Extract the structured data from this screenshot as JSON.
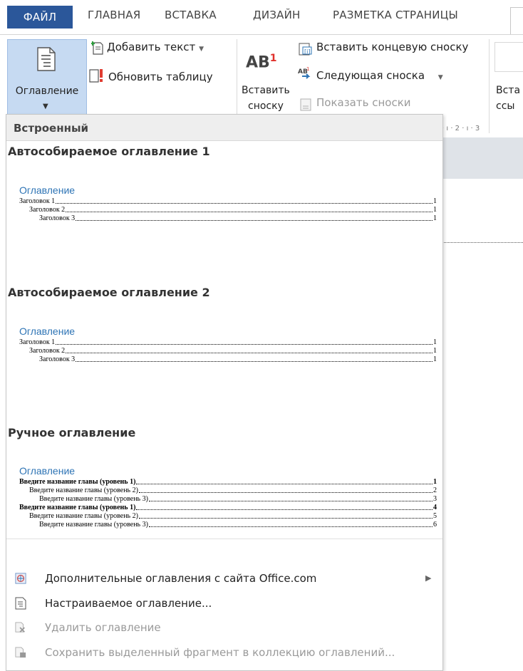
{
  "tabs": [
    "ФАЙЛ",
    "ГЛАВНАЯ",
    "ВСТАВКА",
    "ДИЗАЙН",
    "РАЗМЕТКА СТРАНИЦЫ"
  ],
  "ribbon": {
    "toc_button": "Оглавление",
    "add_text": "Добавить текст",
    "update_table": "Обновить таблицу",
    "insert_footnote_1": "Вставить",
    "insert_footnote_2": "сноску",
    "insert_endnote": "Вставить концевую сноску",
    "next_footnote": "Следующая сноска",
    "show_notes": "Показать сноски",
    "cut_1": "Вста",
    "cut_2": "ссы",
    "ab_text": "AB",
    "ab_sup": "1"
  },
  "ruler_text": "· ı · 2 · ı · 3",
  "menu": {
    "header": "Встроенный",
    "galleries": [
      {
        "title": "Автособираемое оглавление 1",
        "heading": "Оглавление",
        "rows": [
          {
            "t": "Заголовок 1",
            "p": "1",
            "lvl": 0
          },
          {
            "t": "Заголовок 2",
            "p": "1",
            "lvl": 1
          },
          {
            "t": "Заголовок 3",
            "p": "1",
            "lvl": 2
          }
        ]
      },
      {
        "title": "Автособираемое оглавление 2",
        "heading": "Оглавление",
        "rows": [
          {
            "t": "Заголовок 1",
            "p": "1",
            "lvl": 0
          },
          {
            "t": "Заголовок 2",
            "p": "1",
            "lvl": 1
          },
          {
            "t": "Заголовок 3",
            "p": "1",
            "lvl": 2
          }
        ]
      },
      {
        "title": "Ручное оглавление",
        "heading": "Оглавление",
        "rows": [
          {
            "t": "Введите название главы (уровень 1)",
            "p": "1",
            "lvl": 0,
            "b": true
          },
          {
            "t": "Введите название главы (уровень 2)",
            "p": "2",
            "lvl": 1
          },
          {
            "t": "Введите название главы (уровень 3)",
            "p": "3",
            "lvl": 2
          },
          {
            "t": "Введите название главы (уровень 1)",
            "p": "4",
            "lvl": 0,
            "b": true
          },
          {
            "t": "Введите название главы (уровень 2)",
            "p": "5",
            "lvl": 1
          },
          {
            "t": "Введите название главы (уровень 3)",
            "p": "6",
            "lvl": 2
          }
        ]
      }
    ],
    "footer": {
      "more": "Дополнительные оглавления с сайта Office.com",
      "custom": "Настраиваемое оглавление...",
      "remove": "Удалить оглавление",
      "save": "Сохранить выделенный фрагмент в коллекцию оглавлений..."
    }
  },
  "colors": {
    "file_tab": "#2b579a",
    "toc_heading": "#2e74b5",
    "toc_button_bg": "#c6daf2"
  }
}
